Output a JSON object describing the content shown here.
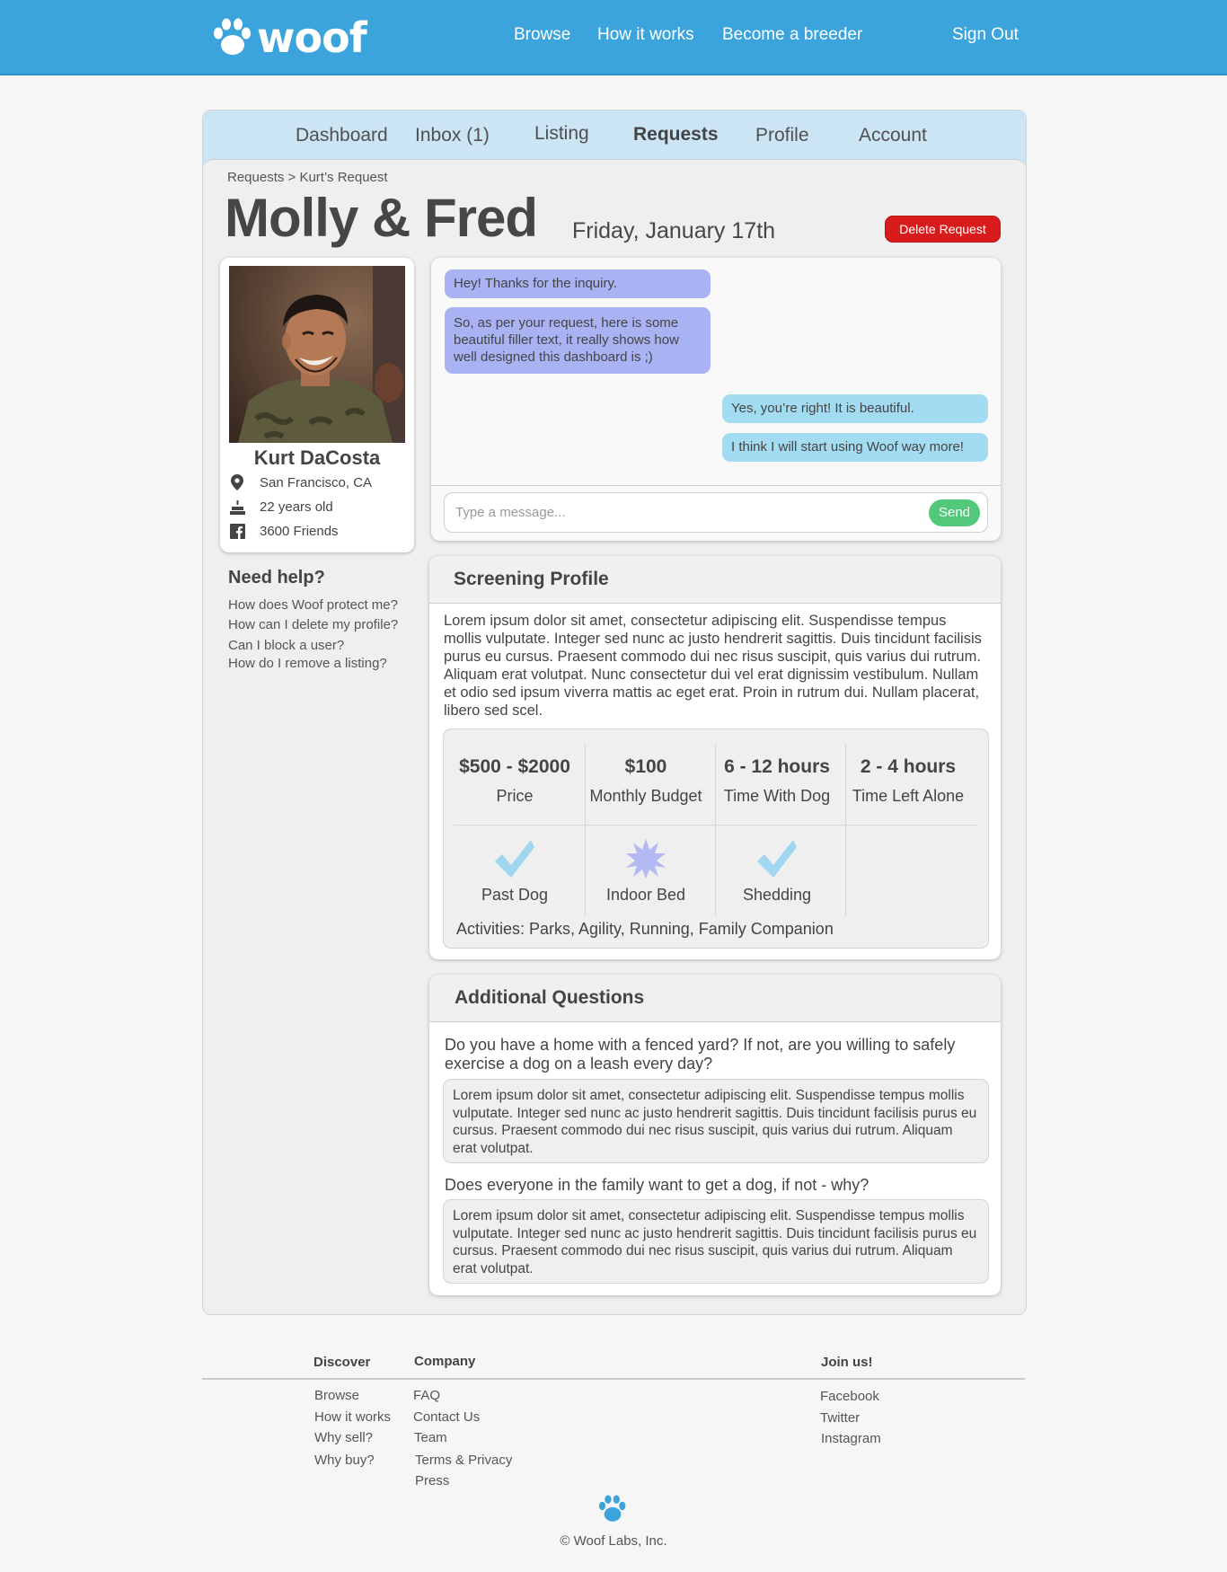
{
  "brand": {
    "logo_text": "woof"
  },
  "topnav": {
    "browse": "Browse",
    "how": "How it works",
    "breeder": "Become a breeder",
    "signout": "Sign Out"
  },
  "tabs": {
    "dashboard": "Dashboard",
    "inbox": "Inbox (1)",
    "listing": "Listing",
    "requests": "Requests",
    "profile": "Profile",
    "account": "Account"
  },
  "breadcrumb": "Requests > Kurt’s Request",
  "request": {
    "title": "Molly & Fred",
    "date": "Friday, January 17th",
    "delete_label": "Delete Request"
  },
  "profile": {
    "name": "Kurt DaCosta",
    "location": "San Francisco, CA",
    "age": "22 years old",
    "friends": "3600 Friends"
  },
  "help": {
    "title": "Need help?",
    "links": [
      "How does Woof protect me?",
      "How can I delete my profile?",
      "Can I block a user?",
      "How do I remove a listing?"
    ]
  },
  "chat": {
    "messages": [
      "Hey! Thanks for the inquiry.",
      "So, as per your request, here is some beautiful filler text, it really shows how well designed this dashboard is ;)",
      "Yes, you’re right! It is beautiful.",
      "I think I will start using Woof way more!"
    ],
    "placeholder": "Type a message...",
    "send_label": "Send"
  },
  "screening": {
    "title": "Screening Profile",
    "text": "Lorem ipsum dolor sit amet, consectetur adipiscing elit. Suspendisse tempus mollis vulputate. Integer sed nunc ac justo hendrerit sagittis. Duis tincidunt facilisis purus eu cursus. Praesent commodo dui nec risus suscipit, quis varius dui rutrum. Aliquam erat volutpat. Nunc consectetur dui vel erat dignissim vestibulum. Nullam et odio sed ipsum viverra mattis ac eget erat. Proin in rutrum dui. Nullam placerat, libero sed scel.",
    "stats": [
      {
        "value": "$500 - $2000",
        "label": "Price"
      },
      {
        "value": "$100",
        "label": "Monthly Budget"
      },
      {
        "value": "6 - 12 hours",
        "label": "Time With Dog"
      },
      {
        "value": "2 - 4 hours",
        "label": "Time Left Alone"
      }
    ],
    "features": [
      {
        "label": "Past Dog",
        "icon": "check-icon"
      },
      {
        "label": "Indoor Bed",
        "icon": "starburst-icon"
      },
      {
        "label": "Shedding",
        "icon": "check-icon"
      }
    ],
    "activities": "Activities: Parks, Agility, Running, Family Companion"
  },
  "questions": {
    "title": "Additional Questions",
    "items": [
      {
        "q": "Do you have a home with a fenced yard? If not, are you willing to safely exercise a dog on a leash every day?",
        "a": "Lorem ipsum dolor sit amet, consectetur adipiscing elit. Suspendisse tempus mollis vulputate. Integer sed nunc ac justo hendrerit sagittis. Duis tincidunt facilisis purus eu cursus. Praesent commodo dui nec risus suscipit, quis varius dui rutrum. Aliquam erat volutpat."
      },
      {
        "q": "Does everyone in the family want to get a dog, if not - why?",
        "a": "Lorem ipsum dolor sit amet, consectetur adipiscing elit. Suspendisse tempus mollis vulputate. Integer sed nunc ac justo hendrerit sagittis. Duis tincidunt facilisis purus eu cursus. Praesent commodo dui nec risus suscipit, quis varius dui rutrum. Aliquam erat volutpat."
      }
    ]
  },
  "footer": {
    "discover": {
      "title": "Discover",
      "links": [
        "Browse",
        "How it works",
        "Why sell?",
        "Why buy?"
      ]
    },
    "company": {
      "title": "Company",
      "links": [
        "FAQ",
        "Contact Us",
        "Team",
        "Terms & Privacy",
        "Press"
      ]
    },
    "join": {
      "title": "Join us!",
      "links": [
        "Facebook",
        "Twitter",
        "Instagram"
      ]
    },
    "copyright": "© Woof Labs, Inc."
  },
  "colors": {
    "brand_blue": "#3ca4dc",
    "delete_red": "#d81b1b",
    "send_green": "#52c97a",
    "bubble_purple": "#a9b2f2",
    "bubble_blue": "#a3dcf2"
  }
}
